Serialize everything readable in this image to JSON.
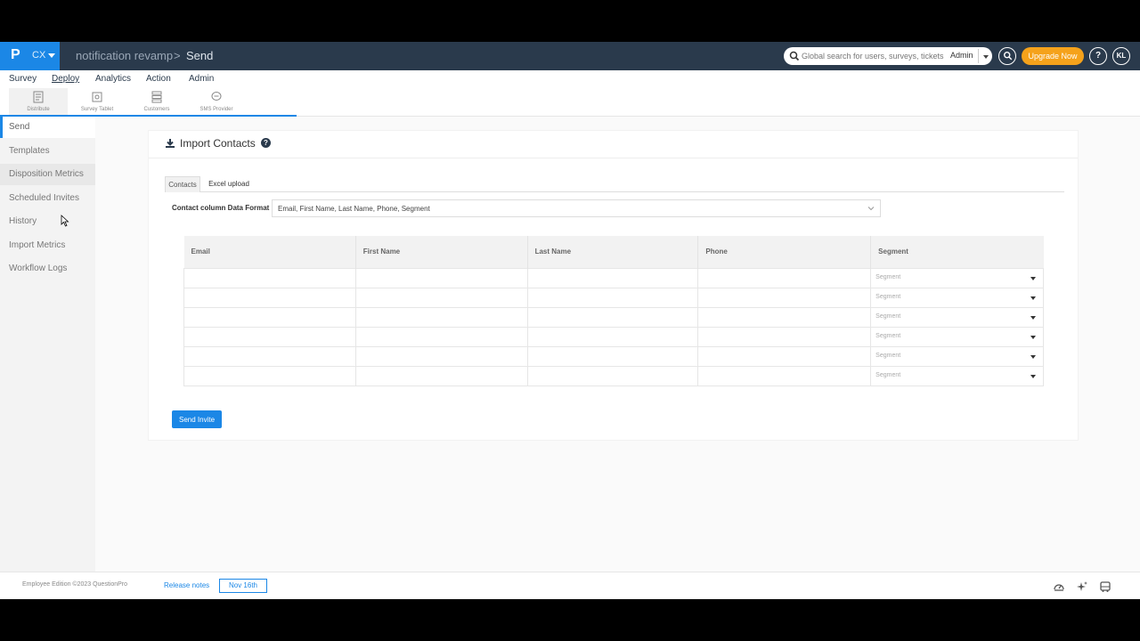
{
  "brand": {
    "logo": "P",
    "product": "CX"
  },
  "breadcrumb": {
    "survey": "notification revamp",
    "separator": ">",
    "current": "Send"
  },
  "search": {
    "placeholder": "Global search for users, surveys, tickets",
    "scope": "Admin"
  },
  "header": {
    "upgrade_label": "Upgrade Now",
    "help_label": "?",
    "avatar_initials": "KL"
  },
  "menu": [
    {
      "label": "Survey"
    },
    {
      "label": "Deploy",
      "active": true
    },
    {
      "label": "Analytics"
    },
    {
      "label": "Action"
    },
    {
      "label": "Admin"
    }
  ],
  "toolbar": [
    {
      "label": "Distribute",
      "icon": "distribute-icon",
      "active": true
    },
    {
      "label": "Survey Tablet",
      "icon": "tablet-icon"
    },
    {
      "label": "Customers",
      "icon": "customers-icon"
    },
    {
      "label": "SMS Provider",
      "icon": "sms-icon"
    }
  ],
  "sidebar": [
    {
      "label": "Send",
      "active": true
    },
    {
      "label": "Templates"
    },
    {
      "label": "Disposition Metrics"
    },
    {
      "label": "Scheduled Invites"
    },
    {
      "label": "History"
    },
    {
      "label": "Import Metrics"
    },
    {
      "label": "Workflow Logs"
    }
  ],
  "panel": {
    "title": "Import Contacts",
    "help": "?",
    "tabs": [
      {
        "label": "Contacts",
        "active": true
      },
      {
        "label": "Excel upload"
      }
    ],
    "format_label": "Contact column Data Format",
    "format_value": "Email, First Name, Last Name, Phone, Segment",
    "columns": [
      "Email",
      "First Name",
      "Last Name",
      "Phone",
      "Segment"
    ],
    "segment_placeholder": "Segment",
    "row_count": 6,
    "send_label": "Send Invite"
  },
  "footer": {
    "copyright": "Employee Edition ©2023 QuestionPro",
    "release_notes": "Release notes",
    "release_date": "Nov 16th"
  },
  "colors": {
    "brand": "#1b87e6",
    "topbar": "#2a3a4c",
    "upgrade": "#f5a21b"
  }
}
